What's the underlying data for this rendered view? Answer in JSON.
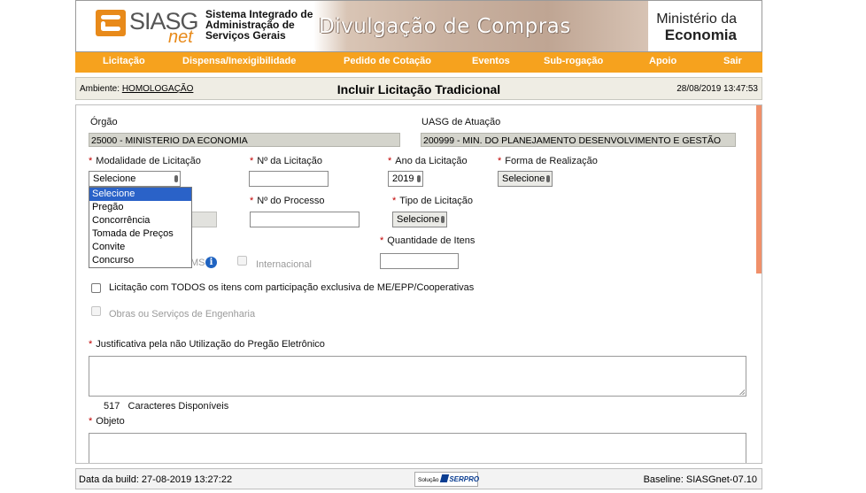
{
  "header": {
    "logo_text": "SIASG",
    "logo_sub": "net",
    "system_title_lines": [
      "Sistema Integrado de",
      "Administração de",
      "Serviços Gerais"
    ],
    "banner_text": "Divulgação de Compras",
    "ministry_line1": "Ministério da",
    "ministry_line2": "Economia"
  },
  "menu": {
    "items": [
      {
        "label": "Licitação"
      },
      {
        "label": "Dispensa/Inexigibilidade"
      },
      {
        "label": "Pedido de Cotação"
      },
      {
        "label": "Eventos"
      },
      {
        "label": "Sub-rogação"
      },
      {
        "label": "Apoio"
      },
      {
        "label": "Sair"
      }
    ]
  },
  "titlebar": {
    "env_label": "Ambiente:",
    "env_value": "HOMOLOGAÇÃO",
    "title": "Incluir Licitação Tradicional",
    "datetime": "28/08/2019 13:47:53"
  },
  "form": {
    "orgao_label": "Órgão",
    "orgao_value": "25000 - MINISTERIO DA ECONOMIA",
    "uasg_label": "UASG de Atuação",
    "uasg_value": "200999 - MIN. DO PLANEJAMENTO DESENVOLVIMENTO E GESTÃO",
    "required_mark": "*",
    "modalidade_label": "Modalidade de Licitação",
    "modalidade_value": "Selecione",
    "modalidade_options": [
      "Selecione",
      "Pregão",
      "Concorrência",
      "Tomada de Preços",
      "Convite",
      "Concurso"
    ],
    "numero_label": "Nº da Licitação",
    "ano_label": "Ano da Licitação",
    "ano_value": "2019",
    "forma_label": "Forma de Realização",
    "forma_value": "Selecione",
    "processo_label": "Nº do Processo",
    "tipo_label": "Tipo de Licitação",
    "tipo_value": "Selecione",
    "qtd_label": "Quantidade de Itens",
    "srp_partial": "MS",
    "internacional_label": "Internacional",
    "me_epp_label": "Licitação com TODOS os itens com participação exclusiva de ME/EPP/Cooperativas",
    "obras_label": "Obras ou Serviços de Engenharia",
    "justificativa_label": "Justificativa pela não Utilização do Pregão Eletrônico",
    "chars_count": "517",
    "chars_label": "Caracteres Disponíveis",
    "objeto_label": "Objeto"
  },
  "footer": {
    "build": "Data da build: 27-08-2019 13:27:22",
    "logo_prefix": "Solução",
    "logo_name": "SERPRO",
    "baseline": "Baseline: SIASGnet-07.10"
  },
  "colors": {
    "menu_bg": "#f6a21e",
    "logo_orange": "#e88a1a",
    "selected_option": "#2a62c8",
    "required": "#c00000",
    "info_icon": "#1f63c1"
  }
}
